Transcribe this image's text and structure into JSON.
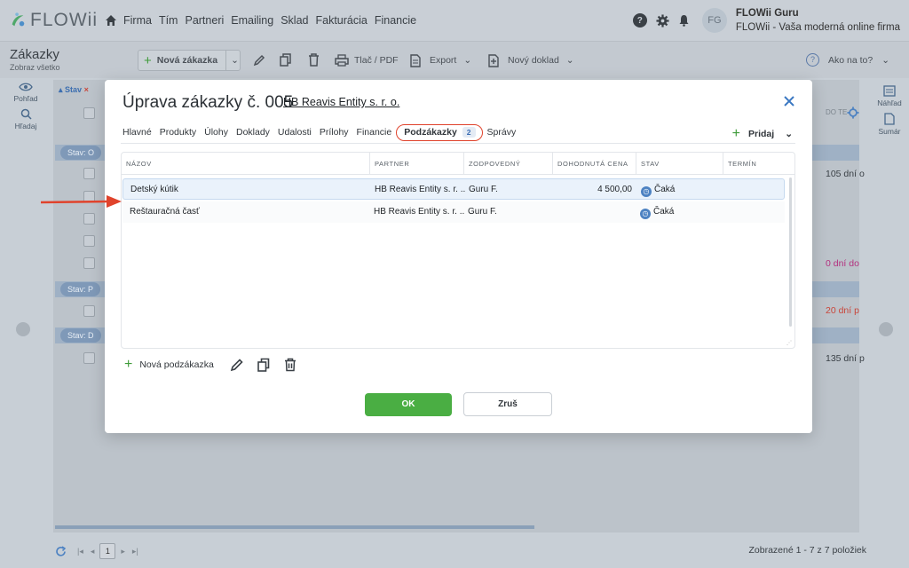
{
  "brand": {
    "name": "FLOWii"
  },
  "topnav": {
    "items": [
      "Firma",
      "Tím",
      "Partneri",
      "Emailing",
      "Sklad",
      "Fakturácia",
      "Financie"
    ]
  },
  "user": {
    "initials": "FG",
    "name": "FLOWii Guru",
    "company": "FLOWii - Vaša moderná online firma"
  },
  "page": {
    "title": "Zákazky",
    "subtitle": "Zobraz všetko"
  },
  "toolbar": {
    "new_label": "Nová zákazka",
    "print_label": "Tlač / PDF",
    "export_label": "Export",
    "new_doc_label": "Nový doklad",
    "help_label": "Ako na to?"
  },
  "left_rail": {
    "view_label": "Pohľad",
    "search_label": "Hľadaj"
  },
  "right_rail": {
    "preview_label": "Náhľad",
    "summary_label": "Sumár"
  },
  "background": {
    "filter_label": "Stav",
    "right_header": "DO TE",
    "groups": [
      "Stav: O",
      "Stav: P",
      "Stav: D"
    ],
    "right_values": [
      {
        "text": "105 dní o",
        "color": "#3a4046"
      },
      {
        "text": "0 dní do",
        "color": "#b3307e"
      },
      {
        "text": "20 dní p",
        "color": "#c9463a"
      },
      {
        "text": "135 dní p",
        "color": "#3a4046"
      }
    ],
    "footer_page": "1",
    "footer_count": "Zobrazené 1 - 7 z 7 položiek"
  },
  "modal": {
    "title": "Úprava zákazky č. 005",
    "partner_link": "HB Reavis Entity s. r. o.",
    "tabs": [
      "Hlavné",
      "Produkty",
      "Úlohy",
      "Doklady",
      "Udalosti",
      "Prílohy",
      "Financie"
    ],
    "active_tab": {
      "label": "Podzákazky",
      "count": "2"
    },
    "tab_after": "Správy",
    "add_label": "Pridaj",
    "columns": [
      "NÁZOV",
      "PARTNER",
      "ZODPOVEDNÝ",
      "DOHODNUTÁ CENA",
      "STAV",
      "TERMÍN"
    ],
    "rows": [
      {
        "name": "Detský kútik",
        "partner": "HB Reavis Entity s. r. ...",
        "owner": "Guru F.",
        "price": "4 500,00",
        "status": "Čaká",
        "deadline": ""
      },
      {
        "name": "Reštauračná časť",
        "partner": "HB Reavis Entity s. r. ...",
        "owner": "Guru F.",
        "price": "",
        "status": "Čaká",
        "deadline": ""
      }
    ],
    "new_sub_label": "Nová podzákazka",
    "ok_label": "OK",
    "cancel_label": "Zruš"
  },
  "colors": {
    "accent_green": "#4aae43",
    "highlight_red": "#e0432c",
    "link_blue": "#3b6db3"
  }
}
